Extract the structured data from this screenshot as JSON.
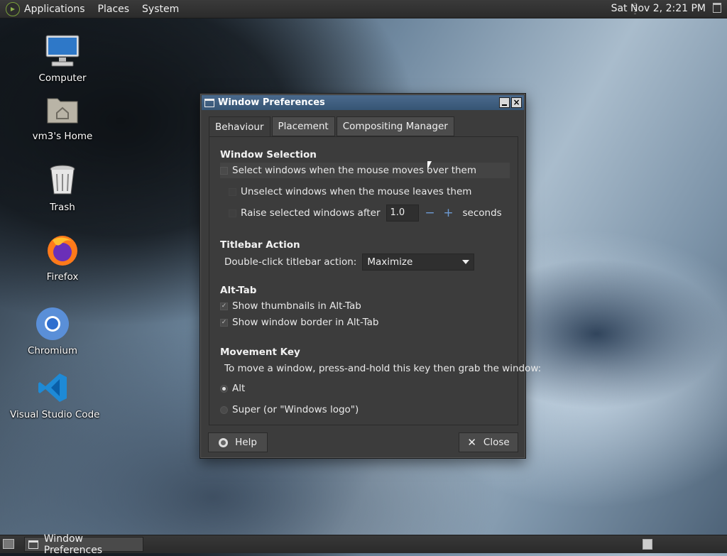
{
  "top_panel": {
    "menus": [
      "Applications",
      "Places",
      "System"
    ],
    "clock": "Sat Nov  2,  2:21 PM"
  },
  "desktop": {
    "icons": [
      {
        "label": "Computer",
        "icon": "computer-icon"
      },
      {
        "label": "vm3's Home",
        "icon": "home-folder-icon"
      },
      {
        "label": "Trash",
        "icon": "trash-icon"
      },
      {
        "label": "Firefox",
        "icon": "firefox-icon"
      },
      {
        "label": "Chromium",
        "icon": "chromium-icon"
      },
      {
        "label": "Visual Studio Code",
        "icon": "vscode-icon"
      }
    ]
  },
  "window": {
    "title": "Window Preferences",
    "tabs": [
      "Behaviour",
      "Placement",
      "Compositing Manager"
    ],
    "active_tab": "Behaviour",
    "window_selection": {
      "title": "Window Selection",
      "select_on_hover": "Select windows when the mouse moves over them",
      "unselect_on_leave": "Unselect windows when the mouse leaves them",
      "raise_after": "Raise selected windows after",
      "raise_value": "1.0",
      "minus": "−",
      "plus": "+",
      "seconds": "seconds"
    },
    "titlebar_action": {
      "title": "Titlebar Action",
      "label": "Double-click titlebar action:",
      "value": "Maximize"
    },
    "alt_tab": {
      "title": "Alt-Tab",
      "thumbnails": "Show thumbnails in Alt-Tab",
      "thumbnails_checked": true,
      "border": "Show window border in Alt-Tab",
      "border_checked": true
    },
    "movement_key": {
      "title": "Movement Key",
      "description": "To move a window, press-and-hold this key then grab the window:",
      "option_alt": "Alt",
      "option_super": "Super (or \"Windows logo\")",
      "selected": "Alt"
    },
    "buttons": {
      "help": "Help",
      "close": "Close"
    }
  },
  "taskbar": {
    "task": "Window Preferences"
  }
}
